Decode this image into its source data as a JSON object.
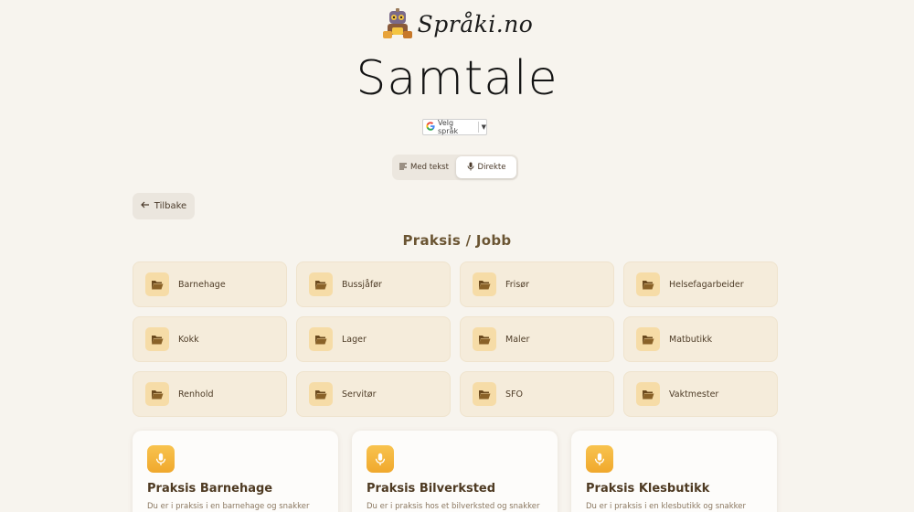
{
  "logo": {
    "text": "Språki.no",
    "icon": "robot-mascot-icon"
  },
  "page": {
    "title": "Samtale"
  },
  "language": {
    "label": "Velg språk",
    "icon": "google-icon"
  },
  "mode_toggle": [
    {
      "label": "Med tekst",
      "icon": "text-lines-icon",
      "active": false
    },
    {
      "label": "Direkte",
      "icon": "microphone-icon",
      "active": true
    }
  ],
  "back": {
    "label": "Tilbake",
    "icon": "arrow-left-icon"
  },
  "section": {
    "title": "Praksis / Jobb"
  },
  "categories": [
    {
      "label": "Barnehage",
      "icon": "folder-open-icon"
    },
    {
      "label": "Bussjåfør",
      "icon": "folder-open-icon"
    },
    {
      "label": "Frisør",
      "icon": "folder-open-icon"
    },
    {
      "label": "Helsefagarbeider",
      "icon": "folder-open-icon"
    },
    {
      "label": "Kokk",
      "icon": "folder-open-icon"
    },
    {
      "label": "Lager",
      "icon": "folder-open-icon"
    },
    {
      "label": "Maler",
      "icon": "folder-open-icon"
    },
    {
      "label": "Matbutikk",
      "icon": "folder-open-icon"
    },
    {
      "label": "Renhold",
      "icon": "folder-open-icon"
    },
    {
      "label": "Servitør",
      "icon": "folder-open-icon"
    },
    {
      "label": "SFO",
      "icon": "folder-open-icon"
    },
    {
      "label": "Vaktmester",
      "icon": "folder-open-icon"
    }
  ],
  "lessons": [
    {
      "title": "Praksis Barnehage",
      "description": "Du er i praksis i en barnehage og snakker",
      "icon": "microphone-icon"
    },
    {
      "title": "Praksis Bilverksted",
      "description": "Du er i praksis hos et bilverksted og snakker",
      "icon": "microphone-icon"
    },
    {
      "title": "Praksis Klesbutikk",
      "description": "Du er i praksis i en klesbutikk og snakker",
      "icon": "microphone-icon"
    }
  ],
  "colors": {
    "background": "#f7f4ee",
    "accent": "#f0a82c",
    "category_card": "#f5ecdb",
    "heading": "#6b5533"
  }
}
